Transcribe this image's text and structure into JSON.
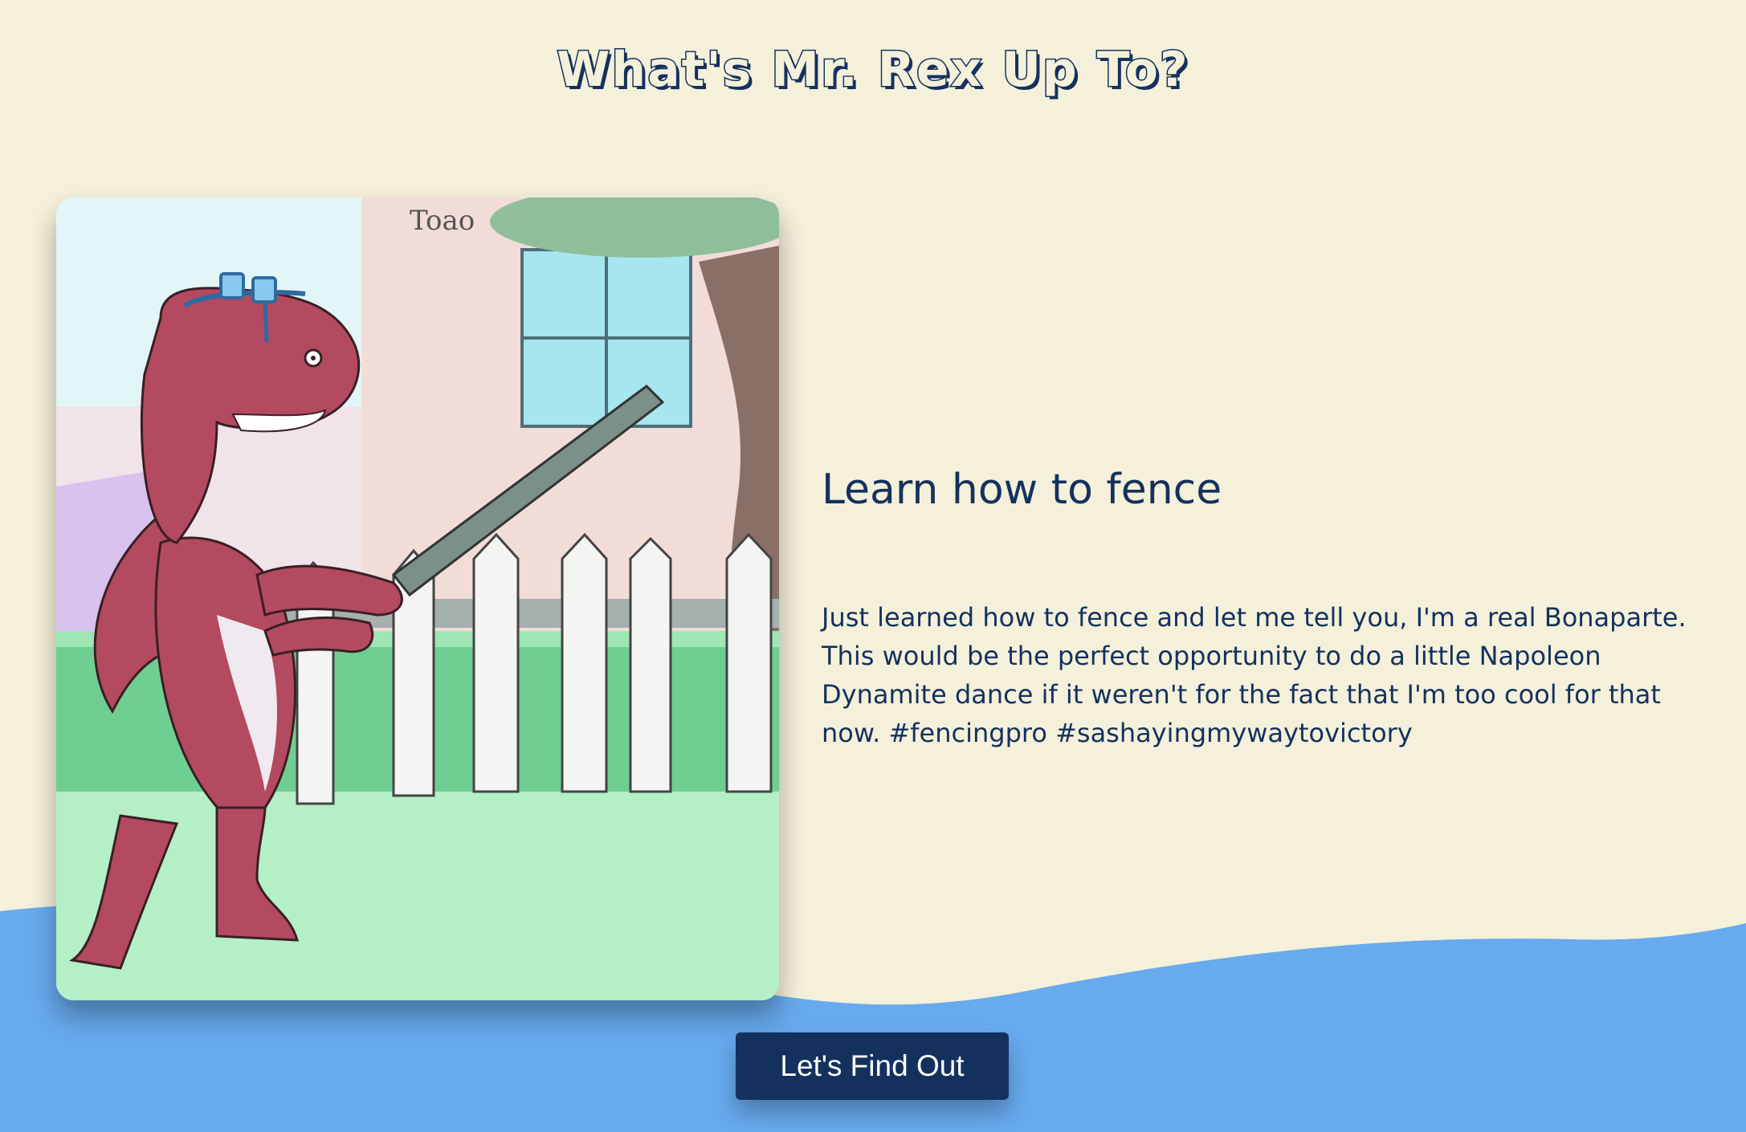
{
  "page": {
    "title": "What's Mr. Rex Up To?",
    "background_color": "#f4f0da",
    "wave_color": "#67aaee",
    "text_color": "#14315e"
  },
  "post": {
    "image_icon": "dinosaur-fencing-illustration",
    "title": "Learn how to fence",
    "body": "Just learned how to fence and let me tell you, I'm a real Bonaparte. This would be the perfect opportunity to do a little Napoleon Dynamite dance if it weren't for the fact that I'm too cool for that now. #fencingpro #sashayingmywaytovictory"
  },
  "cta": {
    "label": "Let's Find Out"
  }
}
